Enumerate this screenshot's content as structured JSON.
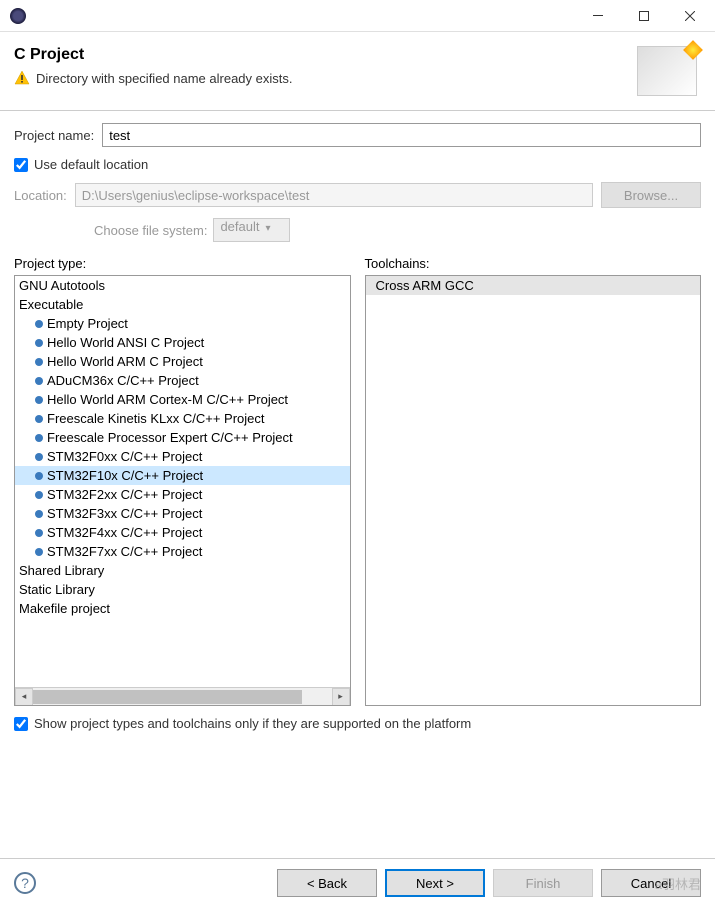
{
  "window": {
    "title": ""
  },
  "header": {
    "title": "C Project",
    "message": "Directory with specified name already exists."
  },
  "form": {
    "project_name_label": "Project name:",
    "project_name_value": "test",
    "use_default_label": "Use default location",
    "use_default_checked": true,
    "location_label": "Location:",
    "location_value": "D:\\Users\\genius\\eclipse-workspace\\test",
    "browse_label": "Browse...",
    "fs_label": "Choose file system:",
    "fs_value": "default",
    "show_supported_label": "Show project types and toolchains only if they are supported on the platform",
    "show_supported_checked": true
  },
  "project_type": {
    "label": "Project type:",
    "items": [
      {
        "text": "GNU Autotools",
        "indent": false,
        "bullet": false,
        "selected": false
      },
      {
        "text": "Executable",
        "indent": false,
        "bullet": false,
        "selected": false
      },
      {
        "text": "Empty Project",
        "indent": true,
        "bullet": true,
        "selected": false
      },
      {
        "text": "Hello World ANSI C Project",
        "indent": true,
        "bullet": true,
        "selected": false
      },
      {
        "text": "Hello World ARM C Project",
        "indent": true,
        "bullet": true,
        "selected": false
      },
      {
        "text": "ADuCM36x C/C++ Project",
        "indent": true,
        "bullet": true,
        "selected": false
      },
      {
        "text": "Hello World ARM Cortex-M C/C++ Project",
        "indent": true,
        "bullet": true,
        "selected": false
      },
      {
        "text": "Freescale Kinetis KLxx C/C++ Project",
        "indent": true,
        "bullet": true,
        "selected": false
      },
      {
        "text": "Freescale Processor Expert C/C++ Project",
        "indent": true,
        "bullet": true,
        "selected": false
      },
      {
        "text": "STM32F0xx C/C++ Project",
        "indent": true,
        "bullet": true,
        "selected": false
      },
      {
        "text": "STM32F10x C/C++ Project",
        "indent": true,
        "bullet": true,
        "selected": true
      },
      {
        "text": "STM32F2xx C/C++ Project",
        "indent": true,
        "bullet": true,
        "selected": false
      },
      {
        "text": "STM32F3xx C/C++ Project",
        "indent": true,
        "bullet": true,
        "selected": false
      },
      {
        "text": "STM32F4xx C/C++ Project",
        "indent": true,
        "bullet": true,
        "selected": false
      },
      {
        "text": "STM32F7xx C/C++ Project",
        "indent": true,
        "bullet": true,
        "selected": false
      },
      {
        "text": "Shared Library",
        "indent": false,
        "bullet": false,
        "selected": false
      },
      {
        "text": "Static Library",
        "indent": false,
        "bullet": false,
        "selected": false
      },
      {
        "text": "Makefile project",
        "indent": false,
        "bullet": false,
        "selected": false
      }
    ]
  },
  "toolchains": {
    "label": "Toolchains:",
    "items": [
      {
        "text": "Cross ARM GCC",
        "selected": true
      }
    ]
  },
  "buttons": {
    "back": "< Back",
    "next": "Next >",
    "finish": "Finish",
    "cancel": "Cancel"
  },
  "watermark": "a羽林君"
}
